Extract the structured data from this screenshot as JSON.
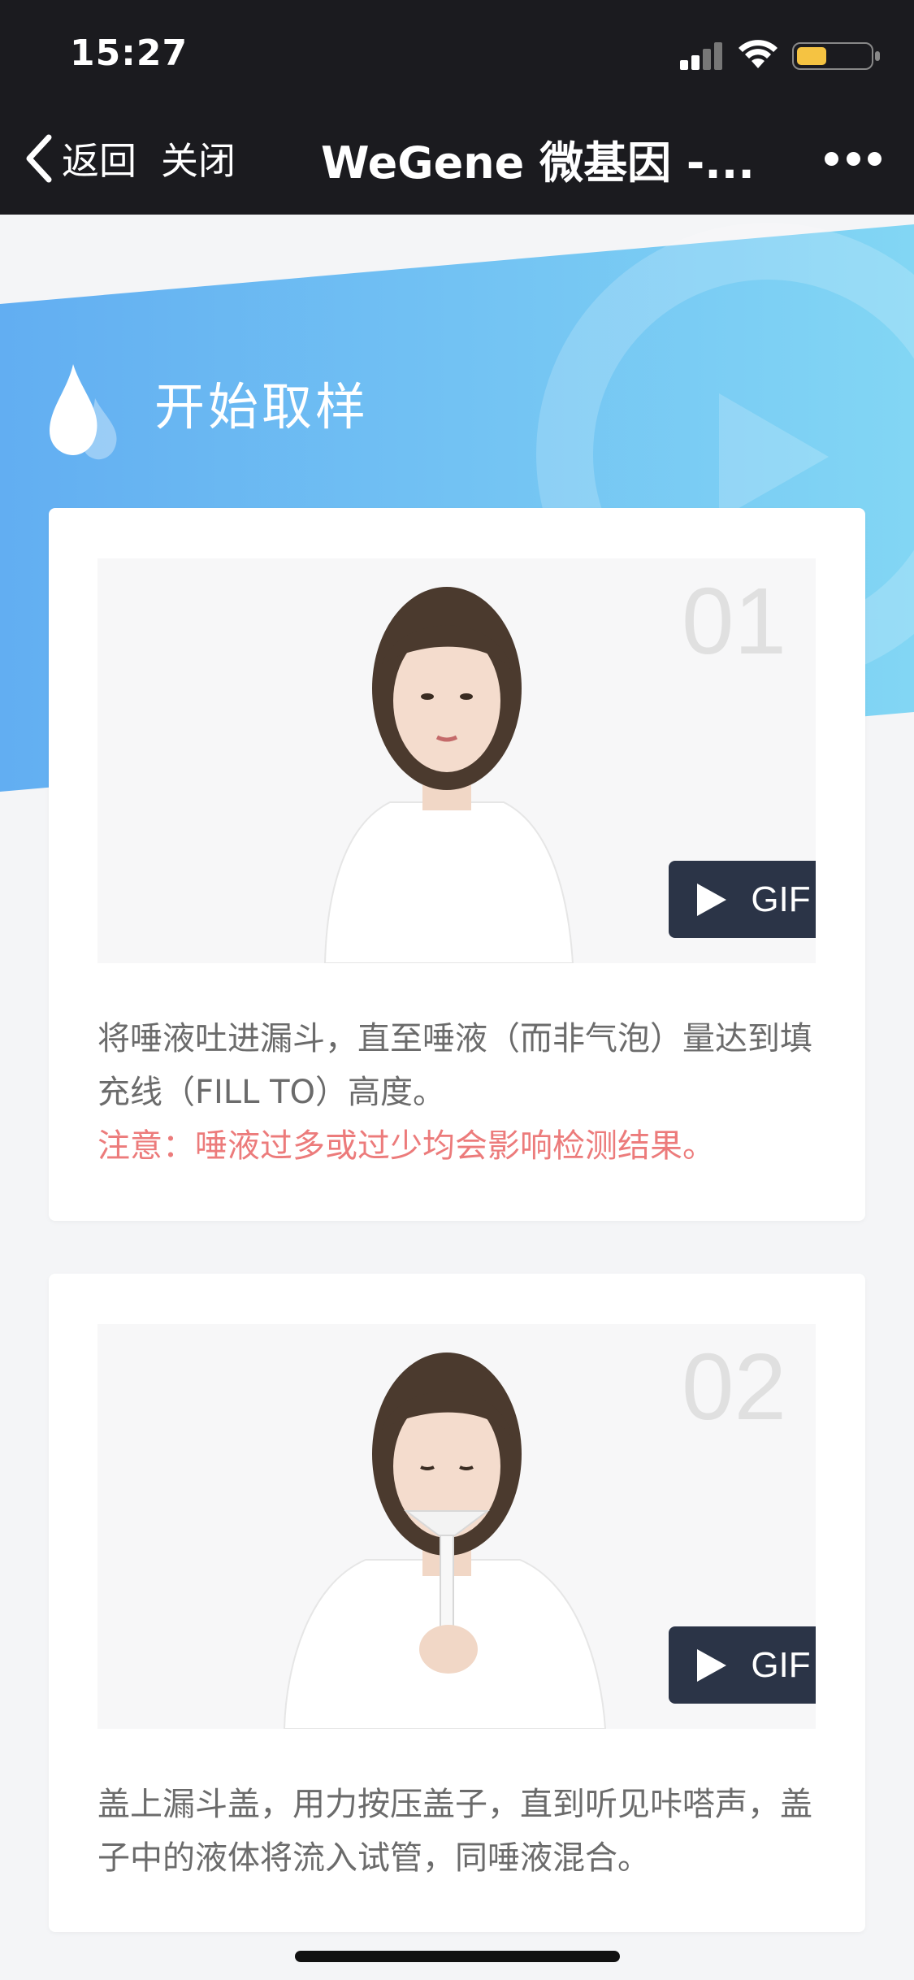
{
  "status_bar": {
    "time": "15:27"
  },
  "nav": {
    "back_label": "返回",
    "close_label": "关闭",
    "title": "WeGene 微基因 -..."
  },
  "section": {
    "title": "开始取样"
  },
  "steps": [
    {
      "number": "01",
      "gif_label": "GIF",
      "text": "将唾液吐进漏斗，直至唾液（而非气泡）量达到填充线（FILL TO）高度。",
      "warning": "注意：唾液过多或过少均会影响检测结果。"
    },
    {
      "number": "02",
      "gif_label": "GIF",
      "text": "盖上漏斗盖，用力按压盖子，直到听见咔嗒声，盖子中的液体将流入试管，同唾液混合。"
    }
  ],
  "colors": {
    "nav_bg": "#1b1b1f",
    "hero_blue": "#6fb6f2",
    "gif_button": "#2b3447",
    "warning": "#ec7b7b"
  }
}
